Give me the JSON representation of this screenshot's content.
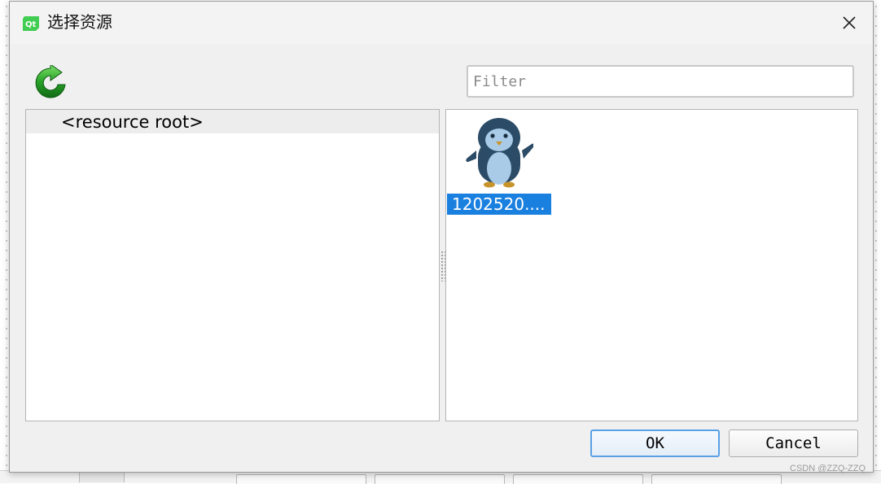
{
  "window": {
    "title": "选择资源",
    "close_icon": "close-icon",
    "app_icon": "qt-logo-icon"
  },
  "toolbar": {
    "refresh_icon": "refresh-icon"
  },
  "filter": {
    "placeholder": "Filter",
    "value": ""
  },
  "tree": {
    "items": [
      {
        "label": "<resource root>",
        "selected": true
      }
    ]
  },
  "files": {
    "items": [
      {
        "label": "1202520....",
        "icon": "penguin-image-icon",
        "selected": true
      }
    ]
  },
  "buttons": {
    "ok_label": "OK",
    "cancel_label": "Cancel"
  },
  "watermark": "CSDN @ZZQ-ZZQ",
  "colors": {
    "selection": "#1a80e0",
    "ok_border": "#5aa0e6"
  }
}
